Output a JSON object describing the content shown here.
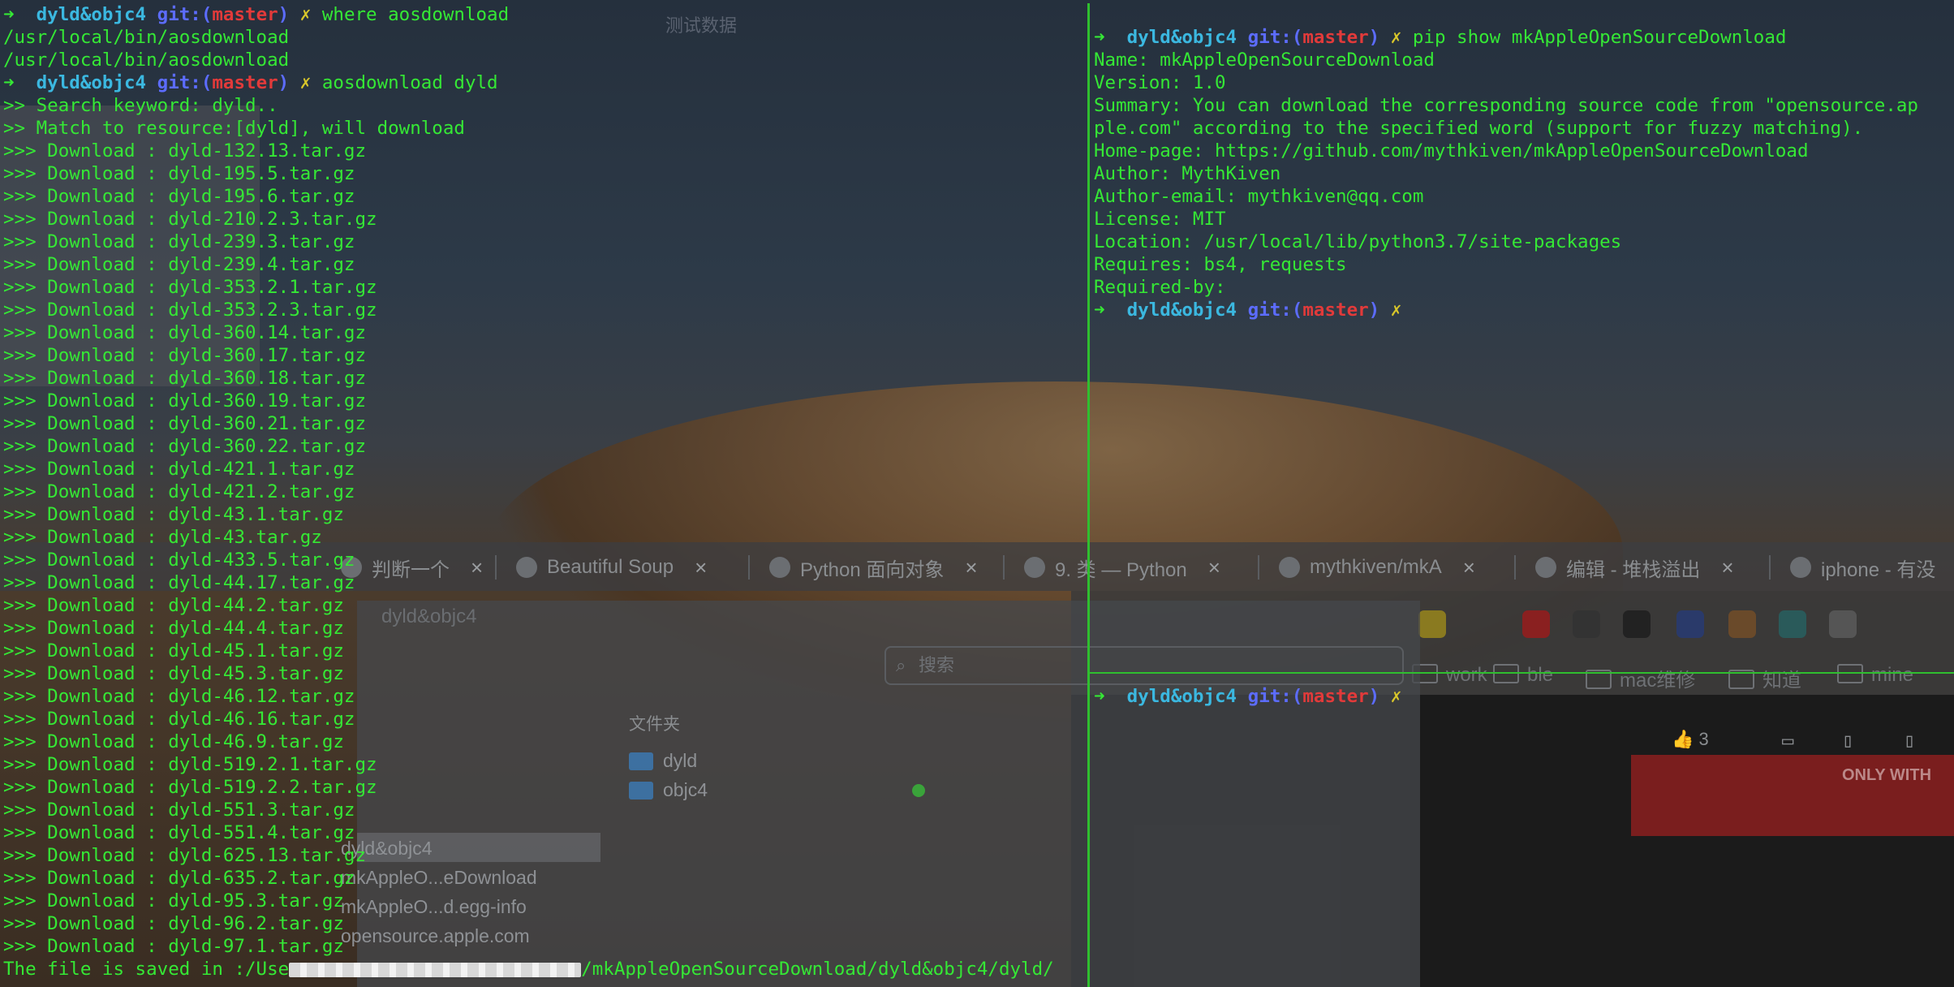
{
  "desktop": {
    "watermark": "测试数据",
    "browser_tabs": [
      {
        "label": "判断一个"
      },
      {
        "label": "Beautiful Soup"
      },
      {
        "label": "Python 面向对象"
      },
      {
        "label": "9. 类 — Python"
      },
      {
        "label": "mythkiven/mkA"
      },
      {
        "label": "编辑 - 堆栈溢出"
      },
      {
        "label": "iphone - 有没"
      }
    ],
    "bookmarks": [
      "work",
      "ble",
      "mac维修",
      "知道",
      "mine"
    ],
    "finder": {
      "title": "dyld&objc4",
      "search_placeholder": "搜索",
      "column_header": "文件夹",
      "folders": [
        "dyld",
        "objc4"
      ],
      "sidebar_items": [
        "dyld&objc4",
        "mkAppleO...eDownload",
        "mkAppleO...d.egg-info",
        "opensource.apple.com"
      ]
    },
    "page": {
      "like_count": "3",
      "banner_text": "ONLY WITH"
    }
  },
  "left_pane": {
    "prompt": {
      "arrow": "➜",
      "dir": "dyld&objc4",
      "git": "git:",
      "branch": "master",
      "dirty": "✗"
    },
    "commands": [
      "where aosdownload",
      "aosdownload dyld"
    ],
    "where_output": [
      "/usr/local/bin/aosdownload",
      "/usr/local/bin/aosdownload"
    ],
    "search_lines": [
      ">> Search keyword: dyld..",
      ">> Match to resource:[dyld], will download"
    ],
    "download_prefix": ">>> Download : ",
    "downloads": [
      "dyld-132.13.tar.gz",
      "dyld-195.5.tar.gz",
      "dyld-195.6.tar.gz",
      "dyld-210.2.3.tar.gz",
      "dyld-239.3.tar.gz",
      "dyld-239.4.tar.gz",
      "dyld-353.2.1.tar.gz",
      "dyld-353.2.3.tar.gz",
      "dyld-360.14.tar.gz",
      "dyld-360.17.tar.gz",
      "dyld-360.18.tar.gz",
      "dyld-360.19.tar.gz",
      "dyld-360.21.tar.gz",
      "dyld-360.22.tar.gz",
      "dyld-421.1.tar.gz",
      "dyld-421.2.tar.gz",
      "dyld-43.1.tar.gz",
      "dyld-43.tar.gz",
      "dyld-433.5.tar.gz",
      "dyld-44.17.tar.gz",
      "dyld-44.2.tar.gz",
      "dyld-44.4.tar.gz",
      "dyld-45.1.tar.gz",
      "dyld-45.3.tar.gz",
      "dyld-46.12.tar.gz",
      "dyld-46.16.tar.gz",
      "dyld-46.9.tar.gz",
      "dyld-519.2.1.tar.gz",
      "dyld-519.2.2.tar.gz",
      "dyld-551.3.tar.gz",
      "dyld-551.4.tar.gz",
      "dyld-625.13.tar.gz",
      "dyld-635.2.tar.gz",
      "dyld-95.3.tar.gz",
      "dyld-96.2.tar.gz",
      "dyld-97.1.tar.gz"
    ],
    "saved_prefix": "The file is saved in :/Use",
    "saved_suffix": "/mkAppleOpenSourceDownload/dyld&objc4/dyld/"
  },
  "right_top_pane": {
    "command": "pip show mkAppleOpenSourceDownload",
    "output": [
      "Name: mkAppleOpenSourceDownload",
      "Version: 1.0",
      "Summary: You can download the corresponding source code from \"opensource.ap",
      "ple.com\" according to the specified word (support for fuzzy matching).",
      "Home-page: https://github.com/mythkiven/mkAppleOpenSourceDownload",
      "Author: MythKiven",
      "Author-email: mythkiven@qq.com",
      "License: MIT",
      "Location: /usr/local/lib/python3.7/site-packages",
      "Requires: bs4, requests",
      "Required-by:"
    ]
  },
  "colors": {
    "text_green": "#35e835",
    "dir_cyan": "#3bb8e0",
    "git_blue": "#5c6cff",
    "branch_red": "#e23a3a",
    "dirty_yellow": "#d9c72a"
  }
}
